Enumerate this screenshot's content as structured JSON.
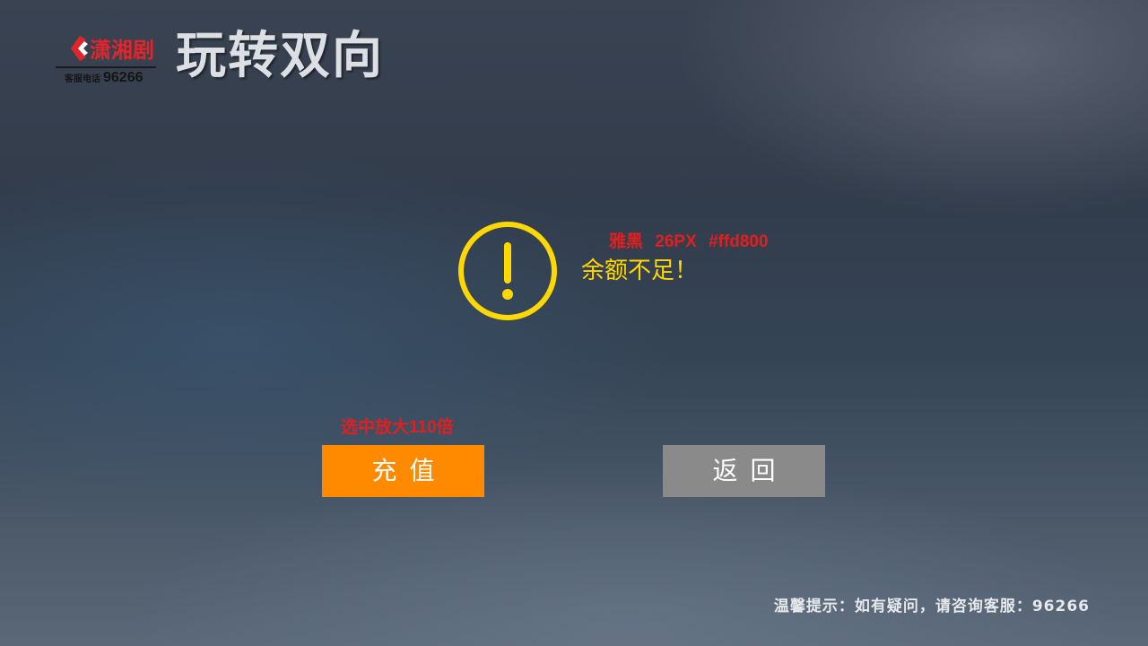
{
  "header": {
    "logo": {
      "brand_text": "潇湘剧",
      "hotline_label": "客服电话",
      "hotline_number": "96266",
      "brand_color": "#e0262b"
    },
    "title": "玩转双向"
  },
  "dialog": {
    "icon": "warning-icon",
    "icon_color": "#ffd800",
    "message": "余额不足！",
    "font_annotation": "雅黑 26PX #ffd800"
  },
  "buttons": {
    "focus_annotation": "选中放大110倍",
    "recharge_label": "充值",
    "recharge_color": "#ff8a00",
    "back_label": "返回",
    "back_color": "#8a8a8a"
  },
  "footer": {
    "tip": "温馨提示：如有疑问，请咨询客服：96266"
  }
}
